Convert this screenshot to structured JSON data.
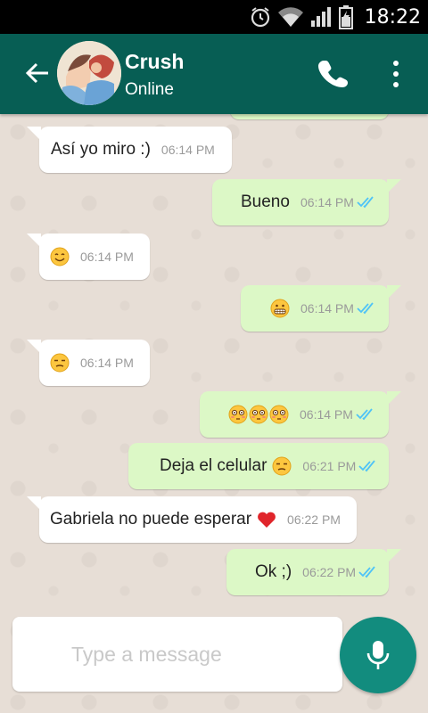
{
  "status_bar": {
    "time": "18:22"
  },
  "contact": {
    "name": "Crush",
    "status": "Online"
  },
  "messages": [
    {
      "direction": "in",
      "text": "Así yo miro :)",
      "time": "06:14 PM"
    },
    {
      "direction": "out",
      "text": "Bueno",
      "time": "06:14 PM"
    },
    {
      "direction": "in",
      "emoji": "smiling-emoji",
      "time": "06:14 PM"
    },
    {
      "direction": "out",
      "emoji": "grimacing-emoji",
      "time": "06:14 PM"
    },
    {
      "direction": "in",
      "emoji": "unamused-emoji",
      "time": "06:14 PM"
    },
    {
      "direction": "out",
      "emoji": "flushed-emoji-x3",
      "time": "06:14 PM"
    },
    {
      "direction": "out",
      "text": "Deja el celular",
      "emoji": "unamused-emoji",
      "time": "06:21 PM"
    },
    {
      "direction": "in",
      "text": "Gabriela no puede esperar",
      "emoji": "red-heart",
      "time": "06:22 PM"
    },
    {
      "direction": "out",
      "text": "Ok ;)",
      "time": "06:22 PM"
    }
  ],
  "composer": {
    "placeholder": "Type a message"
  },
  "colors": {
    "header": "#075e54",
    "outgoing_bubble": "#dcf8c6",
    "incoming_bubble": "#ffffff",
    "read_ticks": "#4fc3f7",
    "mic_button": "#128c7e"
  }
}
